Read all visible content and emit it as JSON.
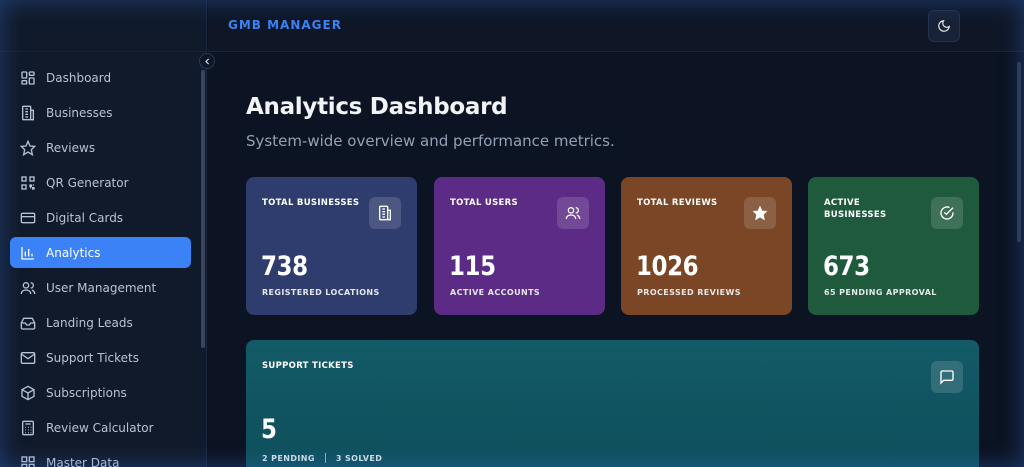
{
  "header": {
    "brand": "GMB MANAGER",
    "theme_icon": "moon-icon"
  },
  "sidebar": {
    "items": [
      {
        "label": "Dashboard",
        "icon": "dashboard-icon",
        "active": false
      },
      {
        "label": "Businesses",
        "icon": "building-icon",
        "active": false
      },
      {
        "label": "Reviews",
        "icon": "star-icon",
        "active": false
      },
      {
        "label": "QR Generator",
        "icon": "qr-icon",
        "active": false
      },
      {
        "label": "Digital Cards",
        "icon": "card-icon",
        "active": false
      },
      {
        "label": "Analytics",
        "icon": "bar-chart-icon",
        "active": true
      },
      {
        "label": "User Management",
        "icon": "users-icon",
        "active": false
      },
      {
        "label": "Landing Leads",
        "icon": "inbox-icon",
        "active": false
      },
      {
        "label": "Support Tickets",
        "icon": "mail-icon",
        "active": false
      },
      {
        "label": "Subscriptions",
        "icon": "box-icon",
        "active": false
      },
      {
        "label": "Review Calculator",
        "icon": "calculator-icon",
        "active": false
      },
      {
        "label": "Master Data",
        "icon": "grid-icon",
        "active": false
      }
    ]
  },
  "main": {
    "title": "Analytics Dashboard",
    "subtitle": "System-wide overview and performance metrics.",
    "cards": [
      {
        "label": "Total Businesses",
        "value": "738",
        "sub": "Registered Locations",
        "icon": "building-icon",
        "color": "#2f3d6e"
      },
      {
        "label": "Total Users",
        "value": "115",
        "sub": "Active Accounts",
        "icon": "users-icon",
        "color": "#5b2b86"
      },
      {
        "label": "Total Reviews",
        "value": "1026",
        "sub": "Processed Reviews",
        "icon": "star-icon",
        "color": "#7a4626"
      },
      {
        "label": "Active Businesses",
        "value": "673",
        "sub": "65 Pending Approval",
        "icon": "check-circle-icon",
        "color": "#1f5a3d"
      }
    ],
    "support": {
      "label": "Support Tickets",
      "value": "5",
      "pending": "2 PENDING",
      "solved": "3 SOLVED",
      "icon": "message-icon",
      "color": "#125a67"
    }
  },
  "colors": {
    "accent": "#3b82f6",
    "background": "#0b1220",
    "sidebar": "#111a2b"
  }
}
